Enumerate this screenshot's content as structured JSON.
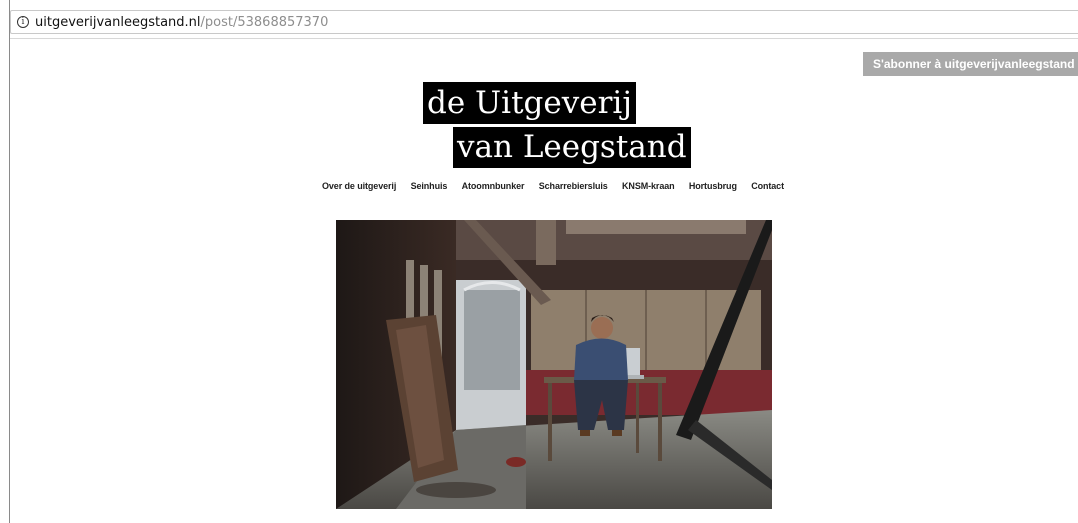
{
  "browser": {
    "url_host": "uitgeverijvanleegstand.nl",
    "url_path": "/post/53868857370",
    "info_icon": "info-icon"
  },
  "subscribe_label": "S'abonner à uitgeverijvanleegstand",
  "logo": {
    "line1": "de Uitgeverij",
    "line2": "van Leegstand"
  },
  "nav": {
    "items": [
      "Over de uitgeverij",
      "Seinhuis",
      "Atoomnbunker",
      "Scharrebiersluis",
      "KNSM-kraan",
      "Hortusbrug",
      "Contact"
    ]
  },
  "photo": {
    "subject": "man-working-on-laptop-in-derelict-building"
  }
}
